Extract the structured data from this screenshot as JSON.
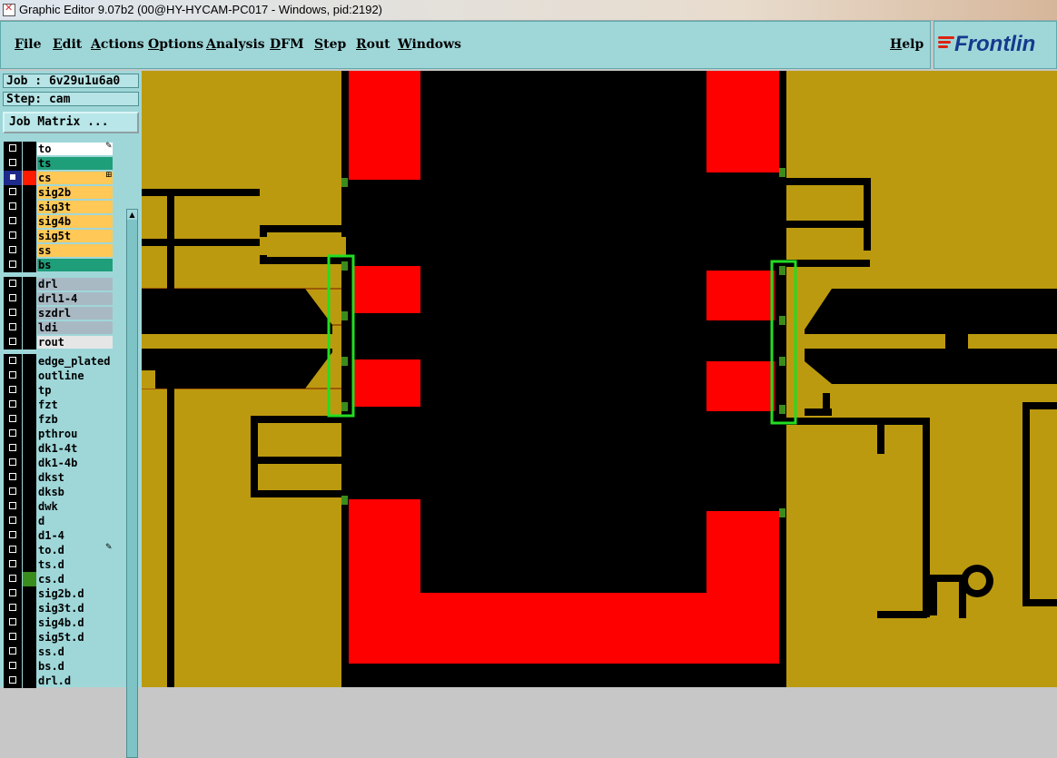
{
  "window": {
    "title": "Graphic Editor 9.07b2 (00@HY-HYCAM-PC017 - Windows, pid:2192)"
  },
  "menu": {
    "items": [
      "File",
      "Edit",
      "Actions",
      "Options",
      "Analysis",
      "DFM",
      "Step",
      "Rout",
      "Windows"
    ],
    "help": "Help"
  },
  "logo": {
    "text": "Frontlin"
  },
  "job": {
    "label": "Job : 6v29u1u6a0",
    "step": "Step: cam",
    "matrix_button": "Job Matrix ..."
  },
  "layers": [
    {
      "name": "to",
      "color": "#ffffff",
      "marker": "✎"
    },
    {
      "name": "ts",
      "color": "#1f9e7a"
    },
    {
      "name": "cs",
      "color": "#ffc857",
      "active": true,
      "swatch": "#ff1a00",
      "marker": "⊞"
    },
    {
      "name": "sig2b",
      "color": "#ffc857"
    },
    {
      "name": "sig3t",
      "color": "#ffc857"
    },
    {
      "name": "sig4b",
      "color": "#ffc857"
    },
    {
      "name": "sig5t",
      "color": "#ffc857"
    },
    {
      "name": "ss",
      "color": "#ffc857"
    },
    {
      "name": "bs",
      "color": "#1f9e7a"
    },
    {
      "name": "drl",
      "color": "#a9b9c4",
      "gap": true
    },
    {
      "name": "drl1-4",
      "color": "#a9b9c4"
    },
    {
      "name": "szdrl",
      "color": "#a9b9c4"
    },
    {
      "name": "ldi",
      "color": "#a9b9c4"
    },
    {
      "name": "rout",
      "color": "#e6e6e6"
    },
    {
      "name": "edge_plated",
      "color": "#9fd7d9",
      "gap": true
    },
    {
      "name": "outline",
      "color": "#9fd7d9"
    },
    {
      "name": "tp",
      "color": "#9fd7d9"
    },
    {
      "name": "fzt",
      "color": "#9fd7d9"
    },
    {
      "name": "fzb",
      "color": "#9fd7d9"
    },
    {
      "name": "pthrou",
      "color": "#9fd7d9"
    },
    {
      "name": "dk1-4t",
      "color": "#9fd7d9"
    },
    {
      "name": "dk1-4b",
      "color": "#9fd7d9"
    },
    {
      "name": "dkst",
      "color": "#9fd7d9"
    },
    {
      "name": "dksb",
      "color": "#9fd7d9"
    },
    {
      "name": "dwk",
      "color": "#9fd7d9"
    },
    {
      "name": "d",
      "color": "#9fd7d9"
    },
    {
      "name": "d1-4",
      "color": "#9fd7d9"
    },
    {
      "name": "to.d",
      "color": "#9fd7d9",
      "marker": "✎"
    },
    {
      "name": "ts.d",
      "color": "#9fd7d9"
    },
    {
      "name": "cs.d",
      "color": "#9fd7d9",
      "swatch": "#3a8c1c"
    },
    {
      "name": "sig2b.d",
      "color": "#9fd7d9"
    },
    {
      "name": "sig3t.d",
      "color": "#9fd7d9"
    },
    {
      "name": "sig4b.d",
      "color": "#9fd7d9"
    },
    {
      "name": "sig5t.d",
      "color": "#9fd7d9"
    },
    {
      "name": "ss.d",
      "color": "#9fd7d9"
    },
    {
      "name": "bs.d",
      "color": "#9fd7d9"
    },
    {
      "name": "drl.d",
      "color": "#9fd7d9"
    }
  ],
  "colors": {
    "copper": "#bc9a0f",
    "trace": "#000000",
    "pad": "#ff0000",
    "highlight": "#22dd22",
    "panel": "#9fd7d9"
  }
}
